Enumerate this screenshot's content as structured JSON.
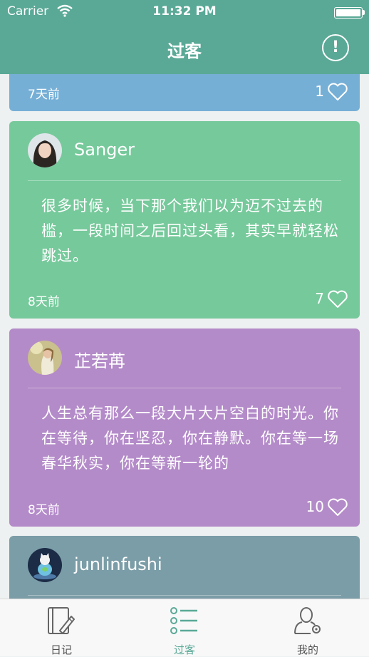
{
  "status_bar": {
    "carrier": "Carrier",
    "time": "11:32 PM"
  },
  "nav": {
    "title": "过客",
    "info_icon": "info-icon",
    "info_glyph": "!"
  },
  "posts": [
    {
      "bg": "#76afd6",
      "time": "7天前",
      "likes": "1"
    },
    {
      "bg": "#76c99b",
      "username": "Sanger",
      "text": "很多时候，当下那个我们以为迈不过去的槛，一段时间之后回过头看，其实早就轻松跳过。",
      "time": "8天前",
      "likes": "7"
    },
    {
      "bg": "#b48bc9",
      "username": "芷若苒",
      "text": "人生总有那么一段大片大片空白的时光。你在等待，你在坚忍，你在静默。你在等一场春华秋实，你在等新一轮的",
      "time": "8天前",
      "likes": "10"
    },
    {
      "bg": "#7b9da7",
      "username": "junlinfushi"
    }
  ],
  "tabbar": {
    "active": 1,
    "tabs": [
      {
        "label": "日记",
        "icon": "diary-icon"
      },
      {
        "label": "过客",
        "icon": "list-icon"
      },
      {
        "label": "我的",
        "icon": "profile-settings-icon"
      }
    ]
  },
  "colors": {
    "accent": "#5aa997",
    "tab_inactive": "#555555"
  }
}
